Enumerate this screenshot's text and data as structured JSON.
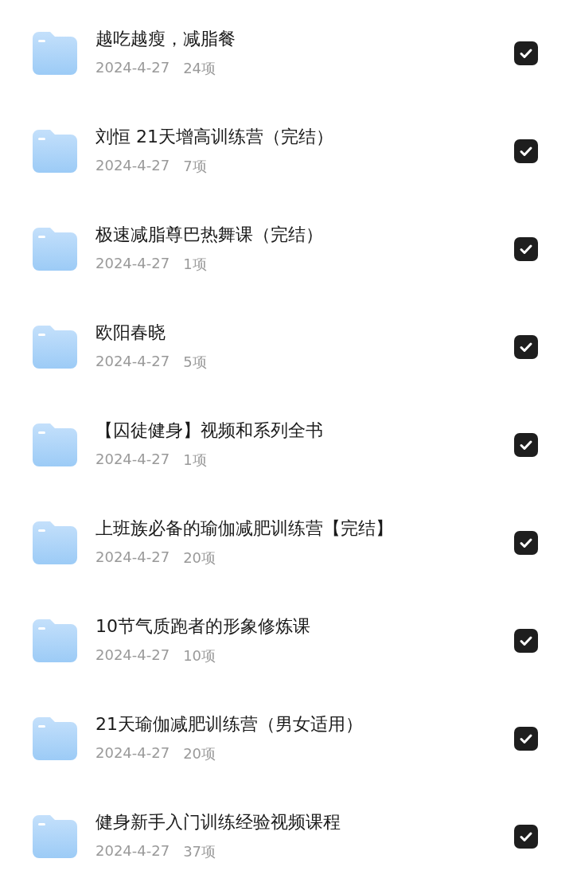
{
  "folders": [
    {
      "name": "越吃越瘦，减脂餐",
      "date": "2024-4-27",
      "count": "24项",
      "checked": true
    },
    {
      "name": "刘恒 21天增高训练营（完结）",
      "date": "2024-4-27",
      "count": "7项",
      "checked": true
    },
    {
      "name": "极速减脂尊巴热舞课（完结）",
      "date": "2024-4-27",
      "count": "1项",
      "checked": true
    },
    {
      "name": "欧阳春晓",
      "date": "2024-4-27",
      "count": "5项",
      "checked": true
    },
    {
      "name": "【囚徒健身】视频和系列全书",
      "date": "2024-4-27",
      "count": "1项",
      "checked": true
    },
    {
      "name": "上班族必备的瑜伽减肥训练营【完结】",
      "date": "2024-4-27",
      "count": "20项",
      "checked": true
    },
    {
      "name": "10节气质跑者的形象修炼课",
      "date": "2024-4-27",
      "count": "10项",
      "checked": true
    },
    {
      "name": "21天瑜伽减肥训练营（男女适用）",
      "date": "2024-4-27",
      "count": "20项",
      "checked": true
    },
    {
      "name": "健身新手入门训练经验视频课程",
      "date": "2024-4-27",
      "count": "37项",
      "checked": true
    }
  ]
}
